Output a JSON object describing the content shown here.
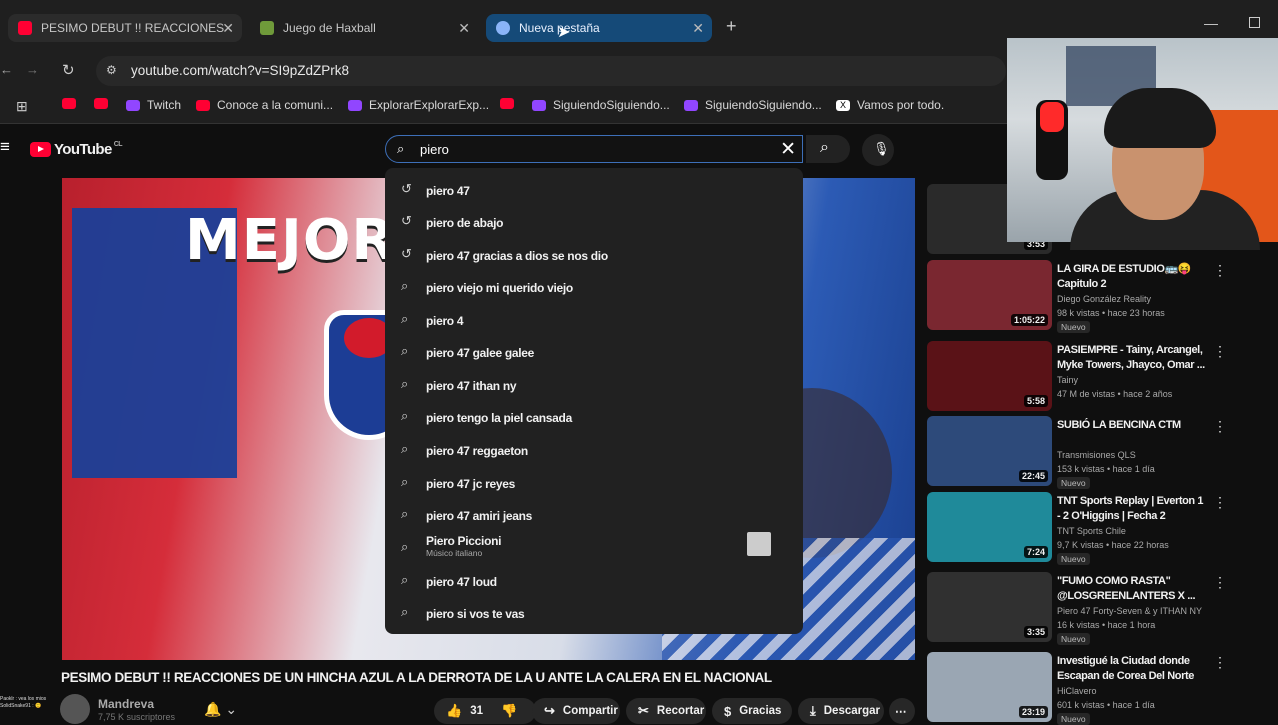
{
  "browser": {
    "tabs": [
      {
        "title": "PESIMO DEBUT !! REACCIONES",
        "active": false
      },
      {
        "title": "Juego de Haxball",
        "active": false
      },
      {
        "title": "Nueva pestaña",
        "active": true
      }
    ],
    "url": "youtube.com/watch?v=SI9pZdZPrk8",
    "bookmarks": [
      "Twitch",
      "Conoce a la comuni...",
      "ExplorarExplorarExp...",
      "SiguiendoSiguiendo...",
      "SiguiendoSiguiendo...",
      "Vamos por todo."
    ]
  },
  "youtube": {
    "logo_text": "YouTube",
    "logo_country": "CL",
    "search_query": "piero",
    "suggestions": [
      {
        "icon": "history",
        "text": "piero 47"
      },
      {
        "icon": "history",
        "text": "piero de abajo"
      },
      {
        "icon": "history",
        "text": "piero 47 gracias a dios se nos dio"
      },
      {
        "icon": "search",
        "text": "piero viejo mi querido viejo"
      },
      {
        "icon": "search",
        "text": "piero 4"
      },
      {
        "icon": "search",
        "text": "piero 47 galee galee"
      },
      {
        "icon": "search",
        "text": "piero 47 ithan ny"
      },
      {
        "icon": "search",
        "text": "piero tengo la piel cansada"
      },
      {
        "icon": "search",
        "text": "piero 47 reggaeton"
      },
      {
        "icon": "search",
        "text": "piero 47 jc reyes"
      },
      {
        "icon": "search",
        "text": "piero 47 amiri jeans"
      },
      {
        "icon": "search",
        "text": "Piero Piccioni",
        "subtitle": "Músico italiano",
        "thumb": true
      },
      {
        "icon": "search",
        "text": "piero 47 loud"
      },
      {
        "icon": "search",
        "text": "piero si vos te vas"
      }
    ],
    "video": {
      "thumb_text": "MEJOR",
      "title": "PESIMO DEBUT !! REACCIONES DE UN HINCHA AZUL A LA DERROTA DE LA U ANTE LA CALERA EN EL NACIONAL",
      "channel": "Mandreva",
      "subscribers": "7,75 K suscriptores",
      "likes": "31",
      "actions": [
        "Compartir",
        "Recortar",
        "Gracias",
        "Descargar"
      ]
    },
    "related": [
      {
        "title": "",
        "meta1": "",
        "meta2": "",
        "duration": "3:53",
        "badge": "",
        "thumb_color": "#2a2a2a"
      },
      {
        "title": "LA GIRA DE ESTUDIO🚌😝 Capitulo 2",
        "meta1": "Diego González Reality",
        "meta2": "98 k vistas • hace 23 horas",
        "duration": "1:05:22",
        "badge": "Nuevo",
        "thumb_color": "#7a2730"
      },
      {
        "title": "PASIEMPRE - Tainy, Arcangel, Myke Towers, Jhayco, Omar ...",
        "meta1": "Tainy",
        "meta2": "47 M de vistas • hace 2 años",
        "duration": "5:58",
        "badge": "",
        "thumb_color": "#5a1217"
      },
      {
        "title": "SUBIÓ LA BENCINA CTM",
        "meta1": "Transmisiones QLS",
        "meta2": "153 k vistas • hace 1 día",
        "duration": "22:45",
        "badge": "Nuevo",
        "thumb_color": "#2d4a7a"
      },
      {
        "title": "TNT Sports Replay | Everton 1 - 2 O'Higgins | Fecha 2",
        "meta1": "TNT Sports Chile",
        "meta2": "9,7 K vistas • hace 22 horas",
        "duration": "7:24",
        "badge": "Nuevo",
        "thumb_color": "#1f8a9a"
      },
      {
        "title": "\"FUMO COMO RASTA\" @LOSGREENLANTERS X ...",
        "meta1": "Piero 47 Forty-Seven & y ITHAN NY",
        "meta2": "16 k vistas • hace 1 hora",
        "duration": "3:35",
        "badge": "Nuevo",
        "thumb_color": "#303030"
      },
      {
        "title": "Investigué la Ciudad donde Escapan de Corea Del Norte",
        "meta1": "HiClavero",
        "meta2": "601 k vistas • hace 1 día",
        "duration": "23:19",
        "badge": "Nuevo",
        "thumb_color": "#9aa6b3"
      }
    ]
  },
  "chat": [
    "Paoklr : vea los mios",
    "SolidSnake91 : 🙂"
  ]
}
